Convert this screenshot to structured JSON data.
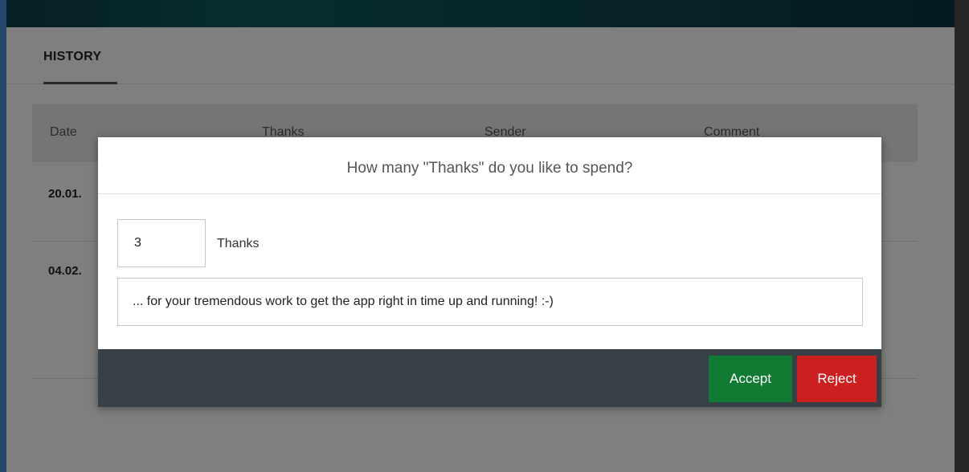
{
  "history_tab": {
    "label": "HISTORY"
  },
  "table": {
    "headers": [
      "Date",
      "Thanks",
      "Sender",
      "Comment"
    ],
    "rows": [
      {
        "date": "20.01."
      },
      {
        "date": "04.02."
      }
    ]
  },
  "dialog": {
    "title": "How many \"Thanks\" do you like to spend?",
    "amount_value": "3",
    "amount_unit": "Thanks",
    "comment_value": "... for your tremendous work to get the app right in time up and running! :-)",
    "accept_label": "Accept",
    "reject_label": "Reject"
  },
  "colors": {
    "accept": "#117a33",
    "reject": "#cc1f1f",
    "footer": "#384047",
    "topbar": "#0d4c57"
  }
}
